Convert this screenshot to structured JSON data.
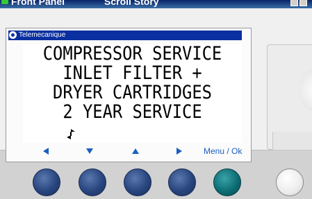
{
  "window": {
    "title": "Front Panel",
    "title_extra": "Scroll Story"
  },
  "brand": {
    "name": "Telemecanique"
  },
  "lcd": {
    "lines": [
      "COMPRESSOR SERVICE",
      "INLET FILTER +",
      "DRYER CARTRIDGES",
      "2 YEAR SERVICE"
    ]
  },
  "nav": {
    "left_icon": "left-triangle",
    "down_icon": "down-triangle",
    "up_icon": "up-triangle",
    "right_icon": "right-triangle",
    "menu_label": "Menu / Ok"
  },
  "colors": {
    "brand_bar": "#0a2fa0",
    "nav_text": "#1a5fbf",
    "key_blue": "#28457e",
    "key_ok": "#0d6e74",
    "key_power": "#ffffff"
  }
}
